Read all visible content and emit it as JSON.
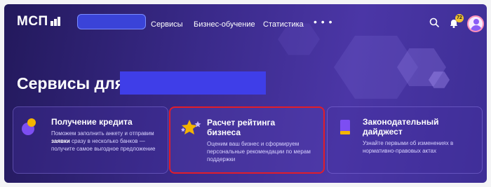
{
  "header": {
    "logo_text": "МСП",
    "nav": [
      {
        "label": "Сервисы"
      },
      {
        "label": "Бизнес-обучение"
      },
      {
        "label": "Статистика"
      }
    ],
    "more_label": "• • •",
    "notification_count": "72"
  },
  "page": {
    "heading": "Сервисы для"
  },
  "cards": [
    {
      "title": "Получение кредита",
      "desc_before": "Поможем заполнить анкету и отправим ",
      "desc_bold": "заявки",
      "desc_after": " сразу в несколько банков — получите самое выгодное предложение",
      "icon": "coins-icon"
    },
    {
      "title": "Расчет рейтинга бизнеса",
      "desc": "Оценим ваш бизнес и сформируем персональные рекомендации по мерам поддержки",
      "icon": "stars-icon"
    },
    {
      "title": "Законодательный дайджест",
      "desc": "Узнайте первыми об изменениях в нормативно-правовых актах",
      "icon": "book-icon"
    }
  ],
  "colors": {
    "background": "#3a2a8a",
    "highlight_border": "#e11d2a",
    "redaction": "#3f3ee8",
    "accent_yellow": "#f4b400",
    "accent_purple": "#7d4ef2"
  }
}
